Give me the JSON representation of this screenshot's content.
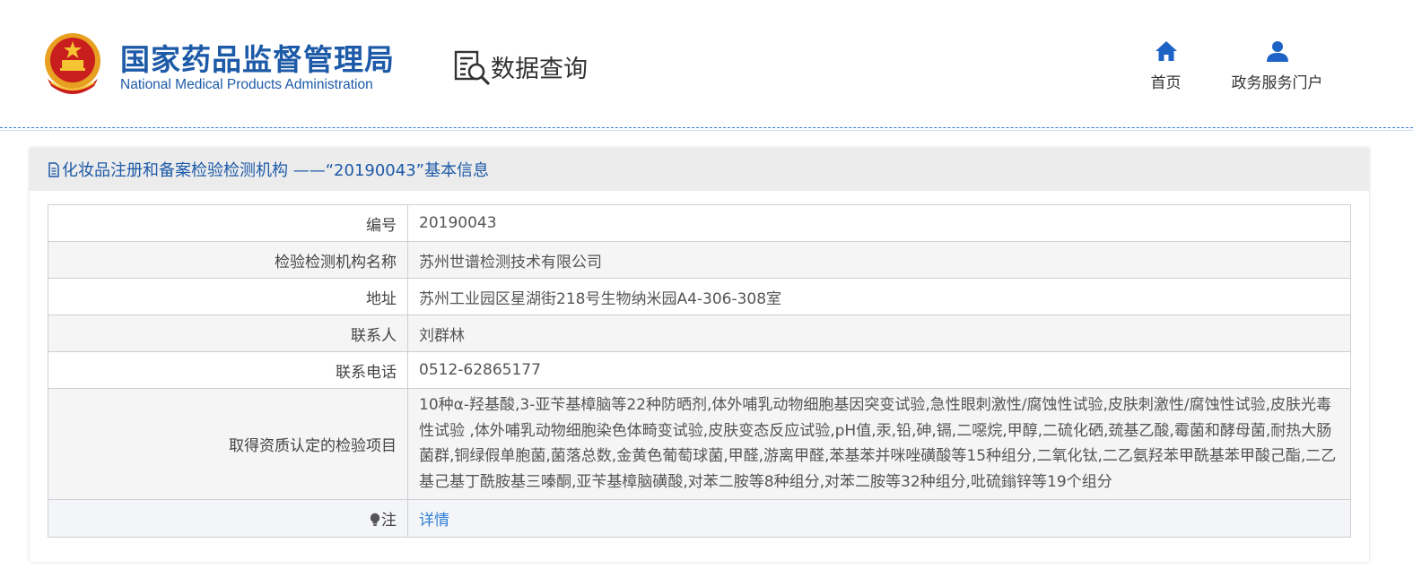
{
  "header": {
    "logo_cn": "国家药品监督管理局",
    "logo_en": "National Medical Products Administration",
    "query_label": "数据查询",
    "nav": [
      {
        "label": "首页",
        "icon": "home-icon"
      },
      {
        "label": "政务服务门户",
        "icon": "user-icon"
      }
    ]
  },
  "panel": {
    "title": "化妆品注册和备案检验检测机构 ——“20190043”基本信息"
  },
  "rows": [
    {
      "label": "编号",
      "value": "20190043"
    },
    {
      "label": "检验检测机构名称",
      "value": "苏州世谱检测技术有限公司"
    },
    {
      "label": "地址",
      "value": "苏州工业园区星湖街218号生物纳米园A4-306-308室"
    },
    {
      "label": "联系人",
      "value": "刘群林"
    },
    {
      "label": "联系电话",
      "value": "0512-62865177"
    },
    {
      "label": "取得资质认定的检验项目",
      "value": "10种α-羟基酸,3-亚苄基樟脑等22种防晒剂,体外哺乳动物细胞基因突变试验,急性眼刺激性/腐蚀性试验,皮肤刺激性/腐蚀性试验,皮肤光毒性试验 ,体外哺乳动物细胞染色体畸变试验,皮肤变态反应试验,pH值,汞,铅,砷,镉,二噁烷,甲醇,二硫化硒,巯基乙酸,霉菌和酵母菌,耐热大肠菌群,铜绿假单胞菌,菌落总数,金黄色葡萄球菌,甲醛,游离甲醛,苯基苯并咪唑磺酸等15种组分,二氧化钛,二乙氨羟苯甲酰基苯甲酸己酯,二乙基己基丁酰胺基三嗪酮,亚苄基樟脑磺酸,对苯二胺等8种组分,对苯二胺等32种组分,吡硫鎓锌等19个组分"
    }
  ],
  "note": {
    "label": "注",
    "link_text": "详情"
  }
}
